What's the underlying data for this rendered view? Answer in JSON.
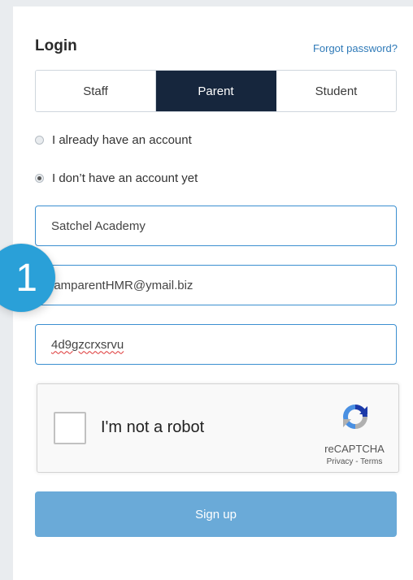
{
  "login": {
    "title": "Login",
    "forgot_password": "Forgot password?"
  },
  "tabs": [
    {
      "label": "Staff",
      "active": false
    },
    {
      "label": "Parent",
      "active": true
    },
    {
      "label": "Student",
      "active": false
    }
  ],
  "radios": [
    {
      "label": "I already have an account",
      "checked": false
    },
    {
      "label": "I don’t have an account yet",
      "checked": true
    }
  ],
  "fields": {
    "school": "Satchel Academy",
    "email": "iamparentHMR@ymail.biz",
    "code": "4d9gzcrxsrvu"
  },
  "step_badge": "1",
  "captcha": {
    "label": "I'm not a robot",
    "brand": "reCAPTCHA",
    "links": "Privacy - Terms"
  },
  "signup_label": "Sign up",
  "colors": {
    "accent": "#16263d",
    "link": "#2f7ab8",
    "field_border": "#3b8fd0",
    "button": "#6aaad8",
    "badge": "#2aa0d8"
  }
}
